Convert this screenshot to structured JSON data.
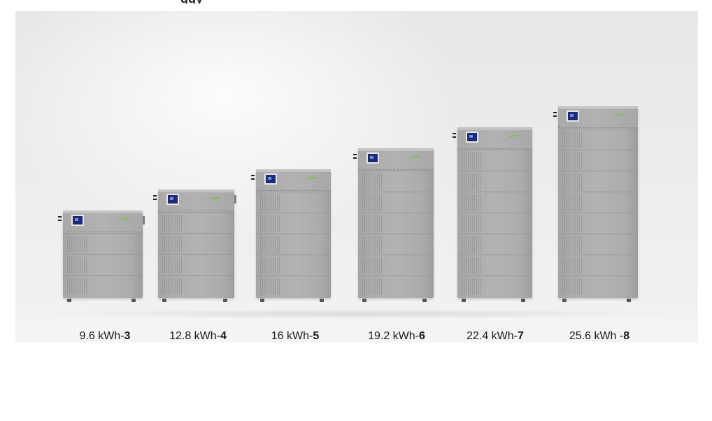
{
  "top_fragment": "ggy",
  "products": [
    {
      "capacity_text": "9.6 kWh-",
      "module_count_text": "3",
      "modules": 3
    },
    {
      "capacity_text": "12.8 kWh-",
      "module_count_text": "4",
      "modules": 4
    },
    {
      "capacity_text": "16 kWh-",
      "module_count_text": "5",
      "modules": 5
    },
    {
      "capacity_text": "19.2 kWh-",
      "module_count_text": "6",
      "modules": 6
    },
    {
      "capacity_text": "22.4 kWh-",
      "module_count_text": "7",
      "modules": 7
    },
    {
      "capacity_text": "25.6 kWh -",
      "module_count_text": "8",
      "modules": 8
    }
  ],
  "colors": {
    "cabinet": "#b0b0b0",
    "screen": "#1d2a78",
    "logo_accent": "#7ac04a",
    "label_text": "#1a1a1a"
  }
}
